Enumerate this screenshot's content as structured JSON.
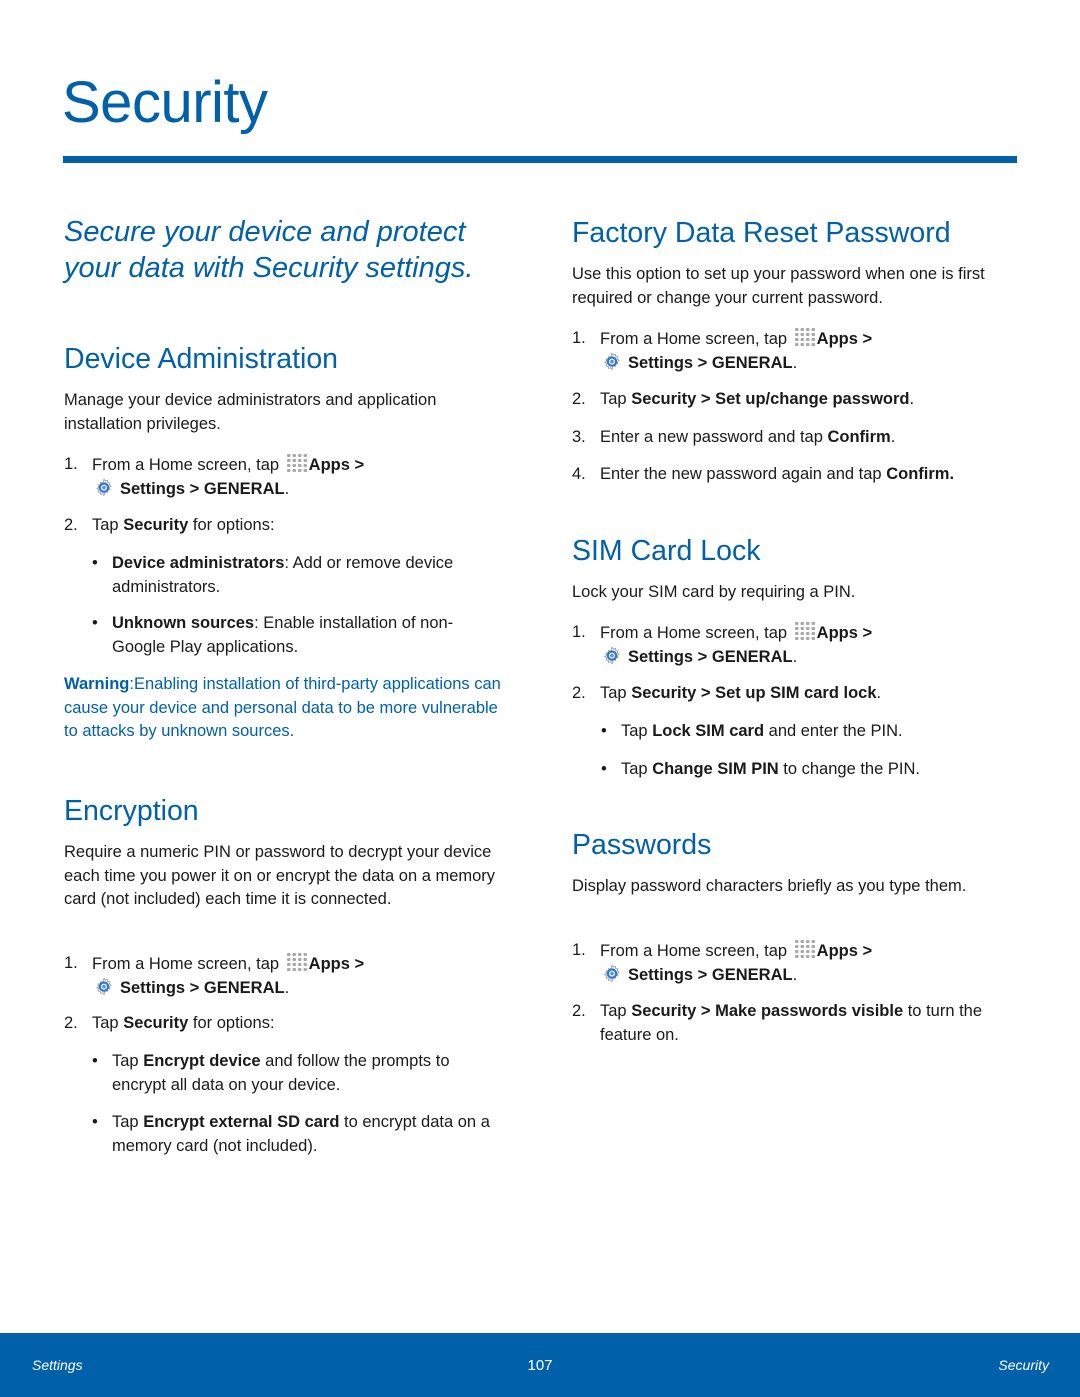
{
  "page": {
    "title": "Security",
    "intro": "Secure your device and protect your data with Security settings."
  },
  "common": {
    "step1_prefix": "From a Home screen, tap ",
    "apps": "Apps",
    "sep": " > ",
    "settings": "Settings",
    "general": "GENERAL",
    "period": ".",
    "tap": "Tap ",
    "security": "Security",
    "bullet": "•"
  },
  "device_admin": {
    "heading": "Device Administration",
    "description": "Manage your device administrators and application installation privileges.",
    "step2_suffix": " for options:",
    "bullets": [
      {
        "bold": "Device administrators",
        "text": ": Add or remove device administrators."
      },
      {
        "bold": "Unknown sources",
        "text": ": Enable installation of non-Google Play applications."
      }
    ],
    "warning_label": "Warning",
    "warning_text": ":Enabling installation of third-party applications can cause your device and personal data to be more vulnerable to attacks by unknown sources."
  },
  "encryption": {
    "heading": "Encryption",
    "description": "Require a numeric PIN or password to decrypt your device each time you power it on or encrypt the data on a memory card (not included) each time it is connected.",
    "step2_suffix": " for options:",
    "bullets": [
      {
        "pre": "Tap ",
        "bold": "Encrypt device",
        "text": " and follow the prompts to encrypt all data on your device."
      },
      {
        "pre": "Tap ",
        "bold": "Encrypt external SD card",
        "text": " to encrypt data on a memory card (not included)."
      }
    ]
  },
  "factory_reset": {
    "heading": "Factory Data Reset Password",
    "description": "Use this option to set up your password when one is first required or change your current password.",
    "step2_bold": "Set up/change password",
    "step3_text": "Enter a new password and tap ",
    "step3_bold": "Confirm",
    "step4_text": "Enter the new password again and tap ",
    "step4_bold": "Confirm"
  },
  "sim_lock": {
    "heading": "SIM Card Lock",
    "description": "Lock your SIM card by requiring a PIN.",
    "step2_bold": "Set up SIM card lock",
    "bullets": [
      {
        "pre": "Tap ",
        "bold": "Lock SIM card",
        "text": " and enter the PIN."
      },
      {
        "pre": "Tap ",
        "bold": "Change SIM PIN",
        "text": " to change the PIN."
      }
    ]
  },
  "passwords": {
    "heading": "Passwords",
    "description": "Display password characters briefly as you type them.",
    "step2_bold": "Make passwords visible",
    "step2_suffix": " to turn the feature on."
  },
  "numbers": [
    "1.",
    "2.",
    "3.",
    "4."
  ],
  "footer": {
    "left": "Settings",
    "page_number": "107",
    "right": "Security"
  },
  "colors": {
    "accent": "#0060a9",
    "text": "#1a1a1a",
    "footer_bg": "#0060a9"
  }
}
